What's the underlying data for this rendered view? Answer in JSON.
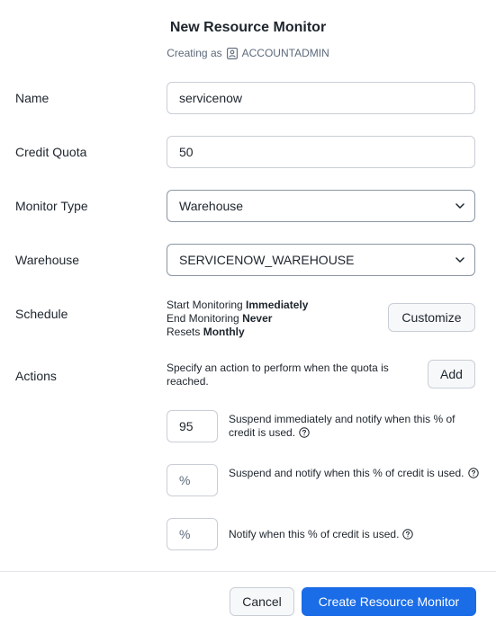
{
  "header": {
    "title": "New Resource Monitor",
    "creating_as_label": "Creating as",
    "role": "ACCOUNTADMIN"
  },
  "form": {
    "name": {
      "label": "Name",
      "value": "servicenow"
    },
    "credit_quota": {
      "label": "Credit Quota",
      "value": "50"
    },
    "monitor_type": {
      "label": "Monitor Type",
      "value": "Warehouse"
    },
    "warehouse": {
      "label": "Warehouse",
      "value": "SERVICENOW_WAREHOUSE"
    },
    "schedule": {
      "label": "Schedule",
      "start_prefix": "Start Monitoring",
      "start_value": "Immediately",
      "end_prefix": "End Monitoring",
      "end_value": "Never",
      "resets_prefix": "Resets",
      "resets_value": "Monthly",
      "customize_label": "Customize"
    },
    "actions": {
      "label": "Actions",
      "description": "Specify an action to perform when the quota is reached.",
      "add_label": "Add",
      "items": [
        {
          "value": "95",
          "placeholder": "%",
          "text": "Suspend immediately and notify when this % of credit is used."
        },
        {
          "value": "",
          "placeholder": "%",
          "text": "Suspend and notify when this % of credit is used."
        },
        {
          "value": "",
          "placeholder": "%",
          "text": "Notify when this % of credit is used."
        }
      ]
    }
  },
  "footer": {
    "cancel_label": "Cancel",
    "create_label": "Create Resource Monitor"
  },
  "colors": {
    "primary": "#1a6ce7",
    "text": "#1e252d",
    "muted": "#5d6a7a",
    "border": "#c9ced6"
  },
  "icons": {
    "role": "user-badge-icon",
    "chevron": "chevron-down-icon",
    "help": "question-circle-icon"
  }
}
